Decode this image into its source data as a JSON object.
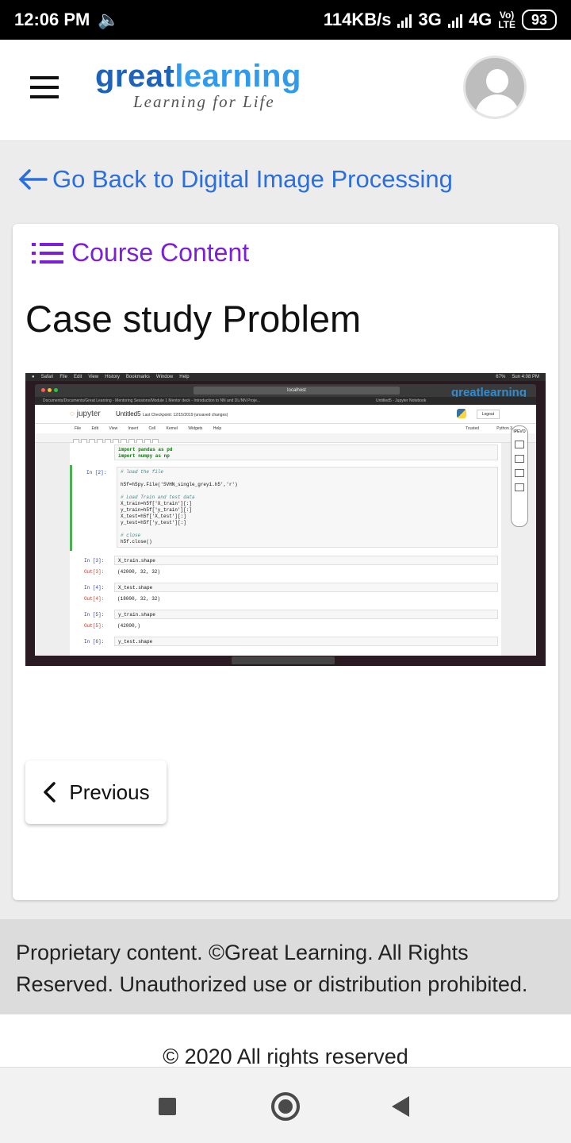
{
  "status_bar": {
    "time": "12:06 PM",
    "speed": "114KB/s",
    "network1": "3G",
    "network2": "4G",
    "volte_top": "Vo)",
    "volte_bottom": "LTE",
    "battery": "93"
  },
  "header": {
    "brand_part1": "great",
    "brand_part2": "learning",
    "tagline": "Learning for Life",
    "brand_colors": {
      "dark": "#1f63b8",
      "light": "#2f9bea"
    }
  },
  "back_link": {
    "label": "Go Back to Digital Image Processing",
    "color": "#2a6fdb"
  },
  "card": {
    "section_label": "Course Content",
    "section_color": "#7b1fd8",
    "page_title": "Case study Problem"
  },
  "embedded_screenshot": {
    "mac_menu": [
      "Safari",
      "File",
      "Edit",
      "View",
      "History",
      "Bookmarks",
      "Window",
      "Help"
    ],
    "clock": "Sun 4:08 PM",
    "battery_pct": "67%",
    "url": "localhost",
    "tab_left": "Documents/Documents/Great Learning - Mentoring Sessions/Module 1 Mentor deck - Introduction to NN and DL/NN Proje...",
    "tab_right": "Untitled5 - Jupyter Notebook",
    "jupyter_brand": "jupyter",
    "notebook_name": "Untitled5",
    "checkpoint": "Last Checkpoint: 12/15/2019  (unsaved changes)",
    "logout": "Logout",
    "menu": [
      "File",
      "Edit",
      "View",
      "Insert",
      "Cell",
      "Kernel",
      "Widgets",
      "Help"
    ],
    "kernel": "Python 3",
    "trusted": "Trusted",
    "cells": {
      "c1_l1": "import pandas as pd",
      "c1_l2": "import numpy as np",
      "c2_prompt": "In [2]:",
      "c2_comment1": "# load the file",
      "c2_l1": "h5f=h5py.File('SVHN_single_grey1.h5','r')",
      "c2_comment2": "# Load Train and test data",
      "c2_l2": "X_train=h5f['X_train'][:]",
      "c2_l3": "y_train=h5f['y_train'][:]",
      "c2_l4": "X_test=h5f['X_test'][:]",
      "c2_l5": "y_test=h5f['y_test'][:]",
      "c2_comment3": "# close",
      "c2_l6": "h5f.close()",
      "c3_prompt": "In [3]:",
      "c3_code": "X_train.shape",
      "c3_out_prompt": "Out[3]:",
      "c3_out": "(42000, 32, 32)",
      "c4_prompt": "In [4]:",
      "c4_code": "X_test.shape",
      "c4_out_prompt": "Out[4]:",
      "c4_out": "(18000, 32, 32)",
      "c5_prompt": "In [5]:",
      "c5_code": "y_train.shape",
      "c5_out_prompt": "Out[5]:",
      "c5_out": "(42000,)",
      "c6_prompt": "In [6]:",
      "c6_code": "y_test.shape"
    },
    "ipevo_label": "IPEVO"
  },
  "previous_button": {
    "label": "Previous"
  },
  "footer": {
    "notice": "Proprietary content. ©Great Learning. All Rights Reserved. Unauthorized use or distribution prohibited.",
    "copyright": "© 2020 All rights reserved"
  }
}
